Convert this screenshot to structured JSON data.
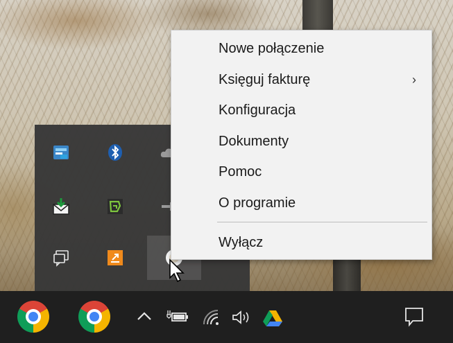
{
  "context_menu": {
    "items": [
      {
        "label": "Nowe połączenie",
        "has_submenu": false
      },
      {
        "label": "Księguj fakturę",
        "has_submenu": true
      },
      {
        "label": "Konfiguracja",
        "has_submenu": false
      },
      {
        "label": "Dokumenty",
        "has_submenu": false
      },
      {
        "label": "Pomoc",
        "has_submenu": false
      },
      {
        "label": "O programie",
        "has_submenu": false
      }
    ],
    "exit_item": {
      "label": "Wyłącz"
    },
    "submenu_arrow": "›"
  },
  "tray_flyout": {
    "icons": [
      "network-app-icon",
      "bluetooth-icon",
      "cloud-icon",
      "mail-download-icon",
      "green-app-icon",
      "usb-icon",
      "message-icon",
      "orange-app-icon",
      "selected-app-icon"
    ]
  },
  "taskbar": {
    "pinned": [
      "chrome-icon",
      "chrome-icon"
    ],
    "tray": [
      "show-hidden-icons-chevron",
      "battery-icon",
      "wifi-icon",
      "volume-icon",
      "google-drive-icon"
    ],
    "action_center": "notification-icon"
  },
  "colors": {
    "menu_bg": "#f2f2f2",
    "flyout_bg": "#383838",
    "taskbar_bg": "#1f1f1f"
  }
}
